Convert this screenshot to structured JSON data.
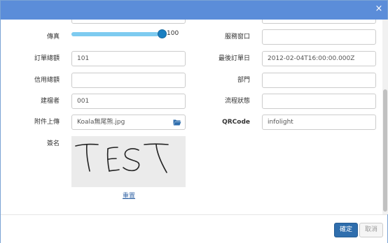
{
  "dialog": {
    "close_symbol": "×"
  },
  "form": {
    "fax": {
      "label": "傳真",
      "slider_value": "100",
      "slider_fraction": 0.95
    },
    "service_window": {
      "label": "服務窗口",
      "value": ""
    },
    "order_total": {
      "label": "訂單總額",
      "value": "101"
    },
    "last_order_date": {
      "label": "最後訂單日",
      "value": "2012-02-04T16:00:00.000Z"
    },
    "credit_total": {
      "label": "信用總額",
      "value": ""
    },
    "department": {
      "label": "部門",
      "value": ""
    },
    "creator": {
      "label": "建檔者",
      "value": "001"
    },
    "flow_status": {
      "label": "流程狀態",
      "value": ""
    },
    "attachment": {
      "label": "附件上傳",
      "value": "Koala無尾熊.jpg",
      "icon": "folder-open-icon"
    },
    "qrcode": {
      "label": "QRCode",
      "value": "infolight"
    },
    "signature": {
      "label": "簽名",
      "reset_label": "重置"
    }
  },
  "footer": {
    "ok_label": "確定",
    "cancel_label": "取消"
  },
  "colors": {
    "title_bar": "#5b8dd9",
    "primary_button": "#2f6ead",
    "slider_handle": "#1a7fc1"
  }
}
